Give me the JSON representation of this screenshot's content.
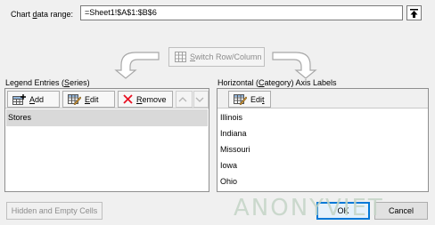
{
  "chart_data_range": {
    "label_pre": "Chart ",
    "label_accel": "d",
    "label_post": "ata range:",
    "value": "=Sheet1!$A$1:$B$6"
  },
  "switch_button": {
    "label_pre": "",
    "label_accel": "S",
    "label_post": "witch Row/Column"
  },
  "legend": {
    "label_pre": "Legend Entries (",
    "label_accel": "S",
    "label_post": "eries)",
    "add_accel": "A",
    "add_rest": "dd",
    "edit_accel": "E",
    "edit_rest": "dit",
    "remove_accel": "R",
    "remove_rest": "emove",
    "series": [
      "Stores"
    ]
  },
  "axis": {
    "label_pre": "Horizontal (",
    "label_accel": "C",
    "label_post": "ategory) Axis Labels",
    "edit_pre": "Edi",
    "edit_accel": "t",
    "categories": [
      "Illinois",
      "Indiana",
      "Missouri",
      "Iowa",
      "Ohio"
    ]
  },
  "footer": {
    "hidden_label": "Hidden and Empty Cells",
    "ok_label": "OK",
    "cancel_label": "Cancel"
  },
  "watermark": "ANONYVIET",
  "colors": {
    "selection": "#d9d9d9",
    "ok_border": "#0078d7",
    "remove_icon": "#e81123"
  }
}
